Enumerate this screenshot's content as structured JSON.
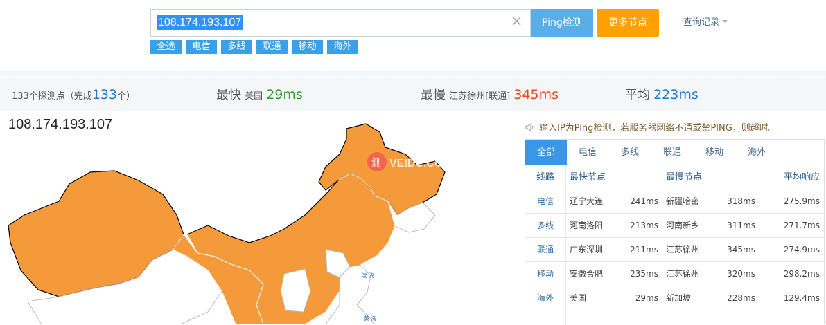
{
  "search": {
    "value": "108.174.193.107"
  },
  "buttons": {
    "ping": "Ping检测",
    "more": "更多节点",
    "history": "查询记录"
  },
  "filters": [
    "全选",
    "电信",
    "多线",
    "联通",
    "移动",
    "海外"
  ],
  "stats": {
    "points_prefix": "133个探测点（完成",
    "points_done": "133",
    "points_suffix": "个）",
    "fastest_label": "最快",
    "fastest_location": "美国",
    "fastest_value": "29ms",
    "slowest_label": "最慢",
    "slowest_location": "江苏徐州[联通]",
    "slowest_value": "345ms",
    "avg_label": "平均",
    "avg_value": "223ms"
  },
  "map": {
    "title": "108.174.193.107",
    "watermark": "测 VEIDC.COM",
    "sea1": "渤 海",
    "sea2": "黄 海",
    "fill": "#f59a3a"
  },
  "notice": "输入IP为Ping检测，若服务器网络不通或禁PING，则超时。",
  "tabs": [
    "全部",
    "电信",
    "多线",
    "联通",
    "移动",
    "海外"
  ],
  "table": {
    "headers": {
      "line": "线路",
      "fast": "最快节点",
      "slow": "最慢节点",
      "avg": "平均响应"
    },
    "rows": [
      {
        "line": "电信",
        "fast_node": "辽宁大连",
        "fast_ms": "241ms",
        "slow_node": "新疆哈密",
        "slow_ms": "318ms",
        "avg": "275.9ms"
      },
      {
        "line": "多线",
        "fast_node": "河南洛阳",
        "fast_ms": "213ms",
        "slow_node": "河南新乡",
        "slow_ms": "311ms",
        "avg": "271.7ms"
      },
      {
        "line": "联通",
        "fast_node": "广东深圳",
        "fast_ms": "211ms",
        "slow_node": "江苏徐州",
        "slow_ms": "345ms",
        "avg": "274.9ms"
      },
      {
        "line": "移动",
        "fast_node": "安徽合肥",
        "fast_ms": "235ms",
        "slow_node": "江苏徐州",
        "slow_ms": "320ms",
        "avg": "298.2ms"
      },
      {
        "line": "海外",
        "fast_node": "美国",
        "fast_ms": "29ms",
        "slow_node": "新加坡",
        "slow_ms": "228ms",
        "avg": "129.4ms"
      }
    ]
  }
}
